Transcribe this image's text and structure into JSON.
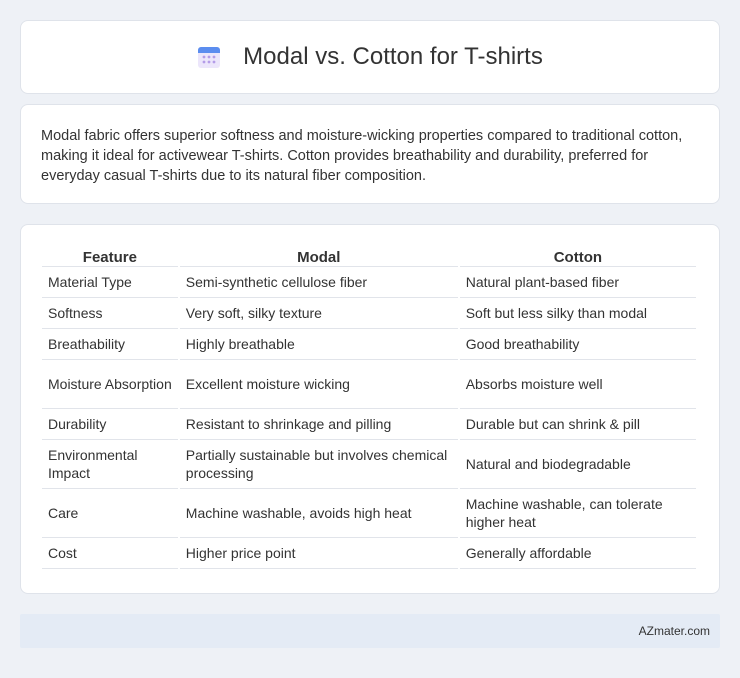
{
  "header": {
    "title": "Modal vs. Cotton for T-shirts",
    "icon": "calendar-icon"
  },
  "intro": {
    "text": "Modal fabric offers superior softness and moisture-wicking properties compared to traditional cotton, making it ideal for activewear T-shirts. Cotton provides breathability and durability, preferred for everyday casual T-shirts due to its natural fiber composition."
  },
  "table": {
    "headers": [
      "Feature",
      "Modal",
      "Cotton"
    ],
    "rows": [
      [
        "Material Type",
        "Semi-synthetic cellulose fiber",
        "Natural plant-based fiber"
      ],
      [
        "Softness",
        "Very soft, silky texture",
        "Soft but less silky than modal"
      ],
      [
        "Breathability",
        "Highly breathable",
        "Good breathability"
      ],
      [
        "Moisture Absorption",
        "Excellent moisture wicking",
        "Absorbs moisture well"
      ],
      [
        "Durability",
        "Resistant to shrinkage and pilling",
        "Durable but can shrink & pill"
      ],
      [
        "Environmental Impact",
        "Partially sustainable but involves chemical processing",
        "Natural and biodegradable"
      ],
      [
        "Care",
        "Machine washable, avoids high heat",
        "Machine washable, can tolerate higher heat"
      ],
      [
        "Cost",
        "Higher price point",
        "Generally affordable"
      ]
    ]
  },
  "footer": {
    "brand": "AZmater.com"
  },
  "colors": {
    "background": "#eef1f6",
    "card": "#ffffff",
    "footer": "#e4ebf5",
    "icon_accent": "#5b8def"
  }
}
